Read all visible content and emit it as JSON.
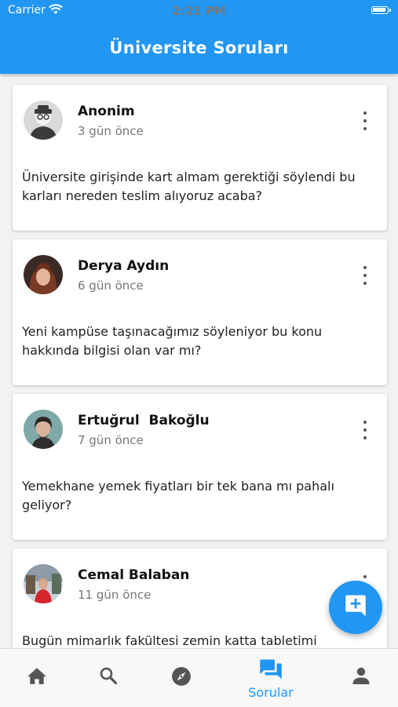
{
  "status_bar": {
    "carrier": "Carrier",
    "time": "2:21 PM"
  },
  "app_bar": {
    "title": "Üniversite Soruları"
  },
  "posts": [
    {
      "author": "Anonim",
      "time": "3 gün önce",
      "question": "Üniversite girişinde kart almam gerektiği söylendi bu karları nereden teslim alıyoruz acaba?"
    },
    {
      "author": "Derya Aydın",
      "time": "6 gün önce",
      "question": "Yeni kampüse taşınacağımız söyleniyor bu konu hakkında bilgisi olan var mı?"
    },
    {
      "author": "Ertuğrul  Bakoğlu",
      "time": "7 gün önce",
      "question": "Yemekhane yemek fiyatları bir tek bana mı pahalı geliyor?"
    },
    {
      "author": "Cemal Balaban",
      "time": "11 gün önce",
      "question": "Bugün mimarlık fakültesi zemin katta tabletimi"
    }
  ],
  "nav": {
    "active_label": "Sorular",
    "accent": "#2196f3",
    "inactive": "#555555"
  },
  "fab": {
    "icon": "add-comment-icon"
  }
}
